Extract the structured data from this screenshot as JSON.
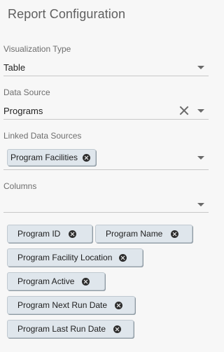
{
  "title": "Report Configuration",
  "visualization_type": {
    "label": "Visualization Type",
    "value": "Table"
  },
  "data_source": {
    "label": "Data Source",
    "value": "Programs"
  },
  "linked_data_sources": {
    "label": "Linked Data Sources",
    "chips": [
      "Program Facilities"
    ]
  },
  "columns": {
    "label": "Columns",
    "value": "",
    "chips": [
      "Program ID",
      "Program Name",
      "Program Facility Location",
      "Program Active",
      "Program Next Run Date",
      "Program Last Run Date"
    ]
  }
}
